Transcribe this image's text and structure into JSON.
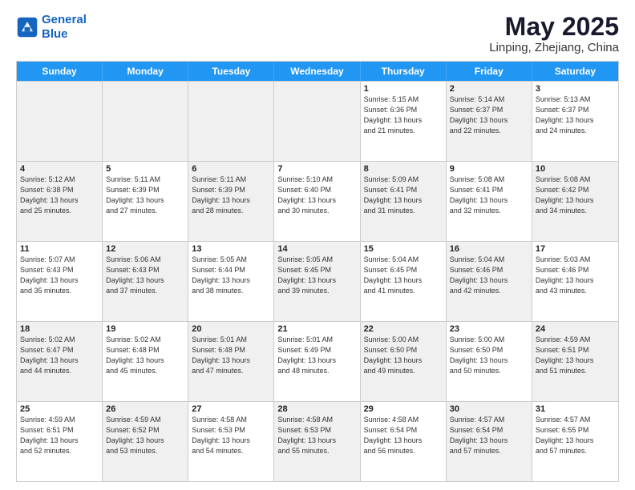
{
  "header": {
    "logo_line1": "General",
    "logo_line2": "Blue",
    "title": "May 2025",
    "subtitle": "Linping, Zhejiang, China"
  },
  "days_of_week": [
    "Sunday",
    "Monday",
    "Tuesday",
    "Wednesday",
    "Thursday",
    "Friday",
    "Saturday"
  ],
  "rows": [
    [
      {
        "day": "",
        "info": "",
        "shaded": true
      },
      {
        "day": "",
        "info": "",
        "shaded": true
      },
      {
        "day": "",
        "info": "",
        "shaded": true
      },
      {
        "day": "",
        "info": "",
        "shaded": true
      },
      {
        "day": "1",
        "info": "Sunrise: 5:15 AM\nSunset: 6:36 PM\nDaylight: 13 hours\nand 21 minutes."
      },
      {
        "day": "2",
        "info": "Sunrise: 5:14 AM\nSunset: 6:37 PM\nDaylight: 13 hours\nand 22 minutes.",
        "shaded": true
      },
      {
        "day": "3",
        "info": "Sunrise: 5:13 AM\nSunset: 6:37 PM\nDaylight: 13 hours\nand 24 minutes."
      }
    ],
    [
      {
        "day": "4",
        "info": "Sunrise: 5:12 AM\nSunset: 6:38 PM\nDaylight: 13 hours\nand 25 minutes.",
        "shaded": true
      },
      {
        "day": "5",
        "info": "Sunrise: 5:11 AM\nSunset: 6:39 PM\nDaylight: 13 hours\nand 27 minutes."
      },
      {
        "day": "6",
        "info": "Sunrise: 5:11 AM\nSunset: 6:39 PM\nDaylight: 13 hours\nand 28 minutes.",
        "shaded": true
      },
      {
        "day": "7",
        "info": "Sunrise: 5:10 AM\nSunset: 6:40 PM\nDaylight: 13 hours\nand 30 minutes."
      },
      {
        "day": "8",
        "info": "Sunrise: 5:09 AM\nSunset: 6:41 PM\nDaylight: 13 hours\nand 31 minutes.",
        "shaded": true
      },
      {
        "day": "9",
        "info": "Sunrise: 5:08 AM\nSunset: 6:41 PM\nDaylight: 13 hours\nand 32 minutes."
      },
      {
        "day": "10",
        "info": "Sunrise: 5:08 AM\nSunset: 6:42 PM\nDaylight: 13 hours\nand 34 minutes.",
        "shaded": true
      }
    ],
    [
      {
        "day": "11",
        "info": "Sunrise: 5:07 AM\nSunset: 6:43 PM\nDaylight: 13 hours\nand 35 minutes."
      },
      {
        "day": "12",
        "info": "Sunrise: 5:06 AM\nSunset: 6:43 PM\nDaylight: 13 hours\nand 37 minutes.",
        "shaded": true
      },
      {
        "day": "13",
        "info": "Sunrise: 5:05 AM\nSunset: 6:44 PM\nDaylight: 13 hours\nand 38 minutes."
      },
      {
        "day": "14",
        "info": "Sunrise: 5:05 AM\nSunset: 6:45 PM\nDaylight: 13 hours\nand 39 minutes.",
        "shaded": true
      },
      {
        "day": "15",
        "info": "Sunrise: 5:04 AM\nSunset: 6:45 PM\nDaylight: 13 hours\nand 41 minutes."
      },
      {
        "day": "16",
        "info": "Sunrise: 5:04 AM\nSunset: 6:46 PM\nDaylight: 13 hours\nand 42 minutes.",
        "shaded": true
      },
      {
        "day": "17",
        "info": "Sunrise: 5:03 AM\nSunset: 6:46 PM\nDaylight: 13 hours\nand 43 minutes."
      }
    ],
    [
      {
        "day": "18",
        "info": "Sunrise: 5:02 AM\nSunset: 6:47 PM\nDaylight: 13 hours\nand 44 minutes.",
        "shaded": true
      },
      {
        "day": "19",
        "info": "Sunrise: 5:02 AM\nSunset: 6:48 PM\nDaylight: 13 hours\nand 45 minutes."
      },
      {
        "day": "20",
        "info": "Sunrise: 5:01 AM\nSunset: 6:48 PM\nDaylight: 13 hours\nand 47 minutes.",
        "shaded": true
      },
      {
        "day": "21",
        "info": "Sunrise: 5:01 AM\nSunset: 6:49 PM\nDaylight: 13 hours\nand 48 minutes."
      },
      {
        "day": "22",
        "info": "Sunrise: 5:00 AM\nSunset: 6:50 PM\nDaylight: 13 hours\nand 49 minutes.",
        "shaded": true
      },
      {
        "day": "23",
        "info": "Sunrise: 5:00 AM\nSunset: 6:50 PM\nDaylight: 13 hours\nand 50 minutes."
      },
      {
        "day": "24",
        "info": "Sunrise: 4:59 AM\nSunset: 6:51 PM\nDaylight: 13 hours\nand 51 minutes.",
        "shaded": true
      }
    ],
    [
      {
        "day": "25",
        "info": "Sunrise: 4:59 AM\nSunset: 6:51 PM\nDaylight: 13 hours\nand 52 minutes."
      },
      {
        "day": "26",
        "info": "Sunrise: 4:59 AM\nSunset: 6:52 PM\nDaylight: 13 hours\nand 53 minutes.",
        "shaded": true
      },
      {
        "day": "27",
        "info": "Sunrise: 4:58 AM\nSunset: 6:53 PM\nDaylight: 13 hours\nand 54 minutes."
      },
      {
        "day": "28",
        "info": "Sunrise: 4:58 AM\nSunset: 6:53 PM\nDaylight: 13 hours\nand 55 minutes.",
        "shaded": true
      },
      {
        "day": "29",
        "info": "Sunrise: 4:58 AM\nSunset: 6:54 PM\nDaylight: 13 hours\nand 56 minutes."
      },
      {
        "day": "30",
        "info": "Sunrise: 4:57 AM\nSunset: 6:54 PM\nDaylight: 13 hours\nand 57 minutes.",
        "shaded": true
      },
      {
        "day": "31",
        "info": "Sunrise: 4:57 AM\nSunset: 6:55 PM\nDaylight: 13 hours\nand 57 minutes."
      }
    ]
  ]
}
